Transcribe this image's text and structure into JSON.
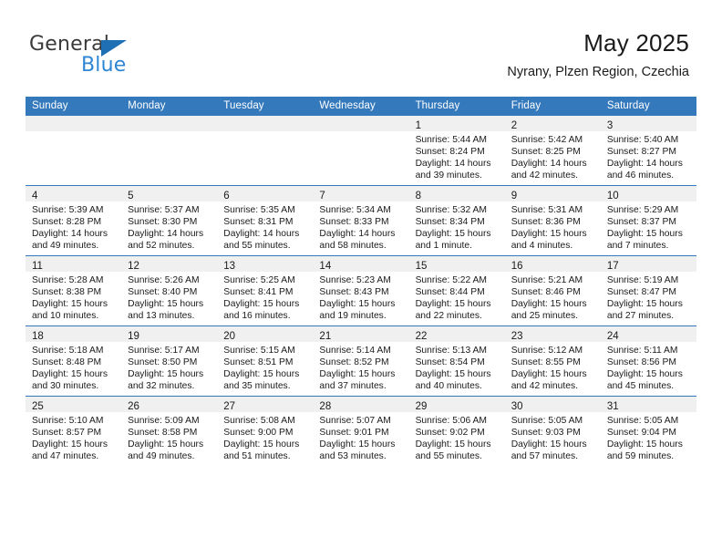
{
  "logo": {
    "word1": "General",
    "word2": "Blue",
    "triangle_color": "#1f6fb5",
    "word2_color": "#2e86d4"
  },
  "header": {
    "title": "May 2025",
    "subtitle": "Nyrany, Plzen Region, Czechia"
  },
  "theme": {
    "header_bg": "#3579bd",
    "daynum_bg": "#f0f0f0",
    "grid_line": "#3579bd"
  },
  "weekday_headers": [
    "Sunday",
    "Monday",
    "Tuesday",
    "Wednesday",
    "Thursday",
    "Friday",
    "Saturday"
  ],
  "weeks": [
    [
      {
        "day": "",
        "empty": true,
        "sunrise": "",
        "sunset": "",
        "daylight1": "",
        "daylight2": ""
      },
      {
        "day": "",
        "empty": true,
        "sunrise": "",
        "sunset": "",
        "daylight1": "",
        "daylight2": ""
      },
      {
        "day": "",
        "empty": true,
        "sunrise": "",
        "sunset": "",
        "daylight1": "",
        "daylight2": ""
      },
      {
        "day": "",
        "empty": true,
        "sunrise": "",
        "sunset": "",
        "daylight1": "",
        "daylight2": ""
      },
      {
        "day": "1",
        "empty": false,
        "sunrise": "Sunrise: 5:44 AM",
        "sunset": "Sunset: 8:24 PM",
        "daylight1": "Daylight: 14 hours",
        "daylight2": "and 39 minutes."
      },
      {
        "day": "2",
        "empty": false,
        "sunrise": "Sunrise: 5:42 AM",
        "sunset": "Sunset: 8:25 PM",
        "daylight1": "Daylight: 14 hours",
        "daylight2": "and 42 minutes."
      },
      {
        "day": "3",
        "empty": false,
        "sunrise": "Sunrise: 5:40 AM",
        "sunset": "Sunset: 8:27 PM",
        "daylight1": "Daylight: 14 hours",
        "daylight2": "and 46 minutes."
      }
    ],
    [
      {
        "day": "4",
        "empty": false,
        "sunrise": "Sunrise: 5:39 AM",
        "sunset": "Sunset: 8:28 PM",
        "daylight1": "Daylight: 14 hours",
        "daylight2": "and 49 minutes."
      },
      {
        "day": "5",
        "empty": false,
        "sunrise": "Sunrise: 5:37 AM",
        "sunset": "Sunset: 8:30 PM",
        "daylight1": "Daylight: 14 hours",
        "daylight2": "and 52 minutes."
      },
      {
        "day": "6",
        "empty": false,
        "sunrise": "Sunrise: 5:35 AM",
        "sunset": "Sunset: 8:31 PM",
        "daylight1": "Daylight: 14 hours",
        "daylight2": "and 55 minutes."
      },
      {
        "day": "7",
        "empty": false,
        "sunrise": "Sunrise: 5:34 AM",
        "sunset": "Sunset: 8:33 PM",
        "daylight1": "Daylight: 14 hours",
        "daylight2": "and 58 minutes."
      },
      {
        "day": "8",
        "empty": false,
        "sunrise": "Sunrise: 5:32 AM",
        "sunset": "Sunset: 8:34 PM",
        "daylight1": "Daylight: 15 hours",
        "daylight2": "and 1 minute."
      },
      {
        "day": "9",
        "empty": false,
        "sunrise": "Sunrise: 5:31 AM",
        "sunset": "Sunset: 8:36 PM",
        "daylight1": "Daylight: 15 hours",
        "daylight2": "and 4 minutes."
      },
      {
        "day": "10",
        "empty": false,
        "sunrise": "Sunrise: 5:29 AM",
        "sunset": "Sunset: 8:37 PM",
        "daylight1": "Daylight: 15 hours",
        "daylight2": "and 7 minutes."
      }
    ],
    [
      {
        "day": "11",
        "empty": false,
        "sunrise": "Sunrise: 5:28 AM",
        "sunset": "Sunset: 8:38 PM",
        "daylight1": "Daylight: 15 hours",
        "daylight2": "and 10 minutes."
      },
      {
        "day": "12",
        "empty": false,
        "sunrise": "Sunrise: 5:26 AM",
        "sunset": "Sunset: 8:40 PM",
        "daylight1": "Daylight: 15 hours",
        "daylight2": "and 13 minutes."
      },
      {
        "day": "13",
        "empty": false,
        "sunrise": "Sunrise: 5:25 AM",
        "sunset": "Sunset: 8:41 PM",
        "daylight1": "Daylight: 15 hours",
        "daylight2": "and 16 minutes."
      },
      {
        "day": "14",
        "empty": false,
        "sunrise": "Sunrise: 5:23 AM",
        "sunset": "Sunset: 8:43 PM",
        "daylight1": "Daylight: 15 hours",
        "daylight2": "and 19 minutes."
      },
      {
        "day": "15",
        "empty": false,
        "sunrise": "Sunrise: 5:22 AM",
        "sunset": "Sunset: 8:44 PM",
        "daylight1": "Daylight: 15 hours",
        "daylight2": "and 22 minutes."
      },
      {
        "day": "16",
        "empty": false,
        "sunrise": "Sunrise: 5:21 AM",
        "sunset": "Sunset: 8:46 PM",
        "daylight1": "Daylight: 15 hours",
        "daylight2": "and 25 minutes."
      },
      {
        "day": "17",
        "empty": false,
        "sunrise": "Sunrise: 5:19 AM",
        "sunset": "Sunset: 8:47 PM",
        "daylight1": "Daylight: 15 hours",
        "daylight2": "and 27 minutes."
      }
    ],
    [
      {
        "day": "18",
        "empty": false,
        "sunrise": "Sunrise: 5:18 AM",
        "sunset": "Sunset: 8:48 PM",
        "daylight1": "Daylight: 15 hours",
        "daylight2": "and 30 minutes."
      },
      {
        "day": "19",
        "empty": false,
        "sunrise": "Sunrise: 5:17 AM",
        "sunset": "Sunset: 8:50 PM",
        "daylight1": "Daylight: 15 hours",
        "daylight2": "and 32 minutes."
      },
      {
        "day": "20",
        "empty": false,
        "sunrise": "Sunrise: 5:15 AM",
        "sunset": "Sunset: 8:51 PM",
        "daylight1": "Daylight: 15 hours",
        "daylight2": "and 35 minutes."
      },
      {
        "day": "21",
        "empty": false,
        "sunrise": "Sunrise: 5:14 AM",
        "sunset": "Sunset: 8:52 PM",
        "daylight1": "Daylight: 15 hours",
        "daylight2": "and 37 minutes."
      },
      {
        "day": "22",
        "empty": false,
        "sunrise": "Sunrise: 5:13 AM",
        "sunset": "Sunset: 8:54 PM",
        "daylight1": "Daylight: 15 hours",
        "daylight2": "and 40 minutes."
      },
      {
        "day": "23",
        "empty": false,
        "sunrise": "Sunrise: 5:12 AM",
        "sunset": "Sunset: 8:55 PM",
        "daylight1": "Daylight: 15 hours",
        "daylight2": "and 42 minutes."
      },
      {
        "day": "24",
        "empty": false,
        "sunrise": "Sunrise: 5:11 AM",
        "sunset": "Sunset: 8:56 PM",
        "daylight1": "Daylight: 15 hours",
        "daylight2": "and 45 minutes."
      }
    ],
    [
      {
        "day": "25",
        "empty": false,
        "sunrise": "Sunrise: 5:10 AM",
        "sunset": "Sunset: 8:57 PM",
        "daylight1": "Daylight: 15 hours",
        "daylight2": "and 47 minutes."
      },
      {
        "day": "26",
        "empty": false,
        "sunrise": "Sunrise: 5:09 AM",
        "sunset": "Sunset: 8:58 PM",
        "daylight1": "Daylight: 15 hours",
        "daylight2": "and 49 minutes."
      },
      {
        "day": "27",
        "empty": false,
        "sunrise": "Sunrise: 5:08 AM",
        "sunset": "Sunset: 9:00 PM",
        "daylight1": "Daylight: 15 hours",
        "daylight2": "and 51 minutes."
      },
      {
        "day": "28",
        "empty": false,
        "sunrise": "Sunrise: 5:07 AM",
        "sunset": "Sunset: 9:01 PM",
        "daylight1": "Daylight: 15 hours",
        "daylight2": "and 53 minutes."
      },
      {
        "day": "29",
        "empty": false,
        "sunrise": "Sunrise: 5:06 AM",
        "sunset": "Sunset: 9:02 PM",
        "daylight1": "Daylight: 15 hours",
        "daylight2": "and 55 minutes."
      },
      {
        "day": "30",
        "empty": false,
        "sunrise": "Sunrise: 5:05 AM",
        "sunset": "Sunset: 9:03 PM",
        "daylight1": "Daylight: 15 hours",
        "daylight2": "and 57 minutes."
      },
      {
        "day": "31",
        "empty": false,
        "sunrise": "Sunrise: 5:05 AM",
        "sunset": "Sunset: 9:04 PM",
        "daylight1": "Daylight: 15 hours",
        "daylight2": "and 59 minutes."
      }
    ]
  ]
}
